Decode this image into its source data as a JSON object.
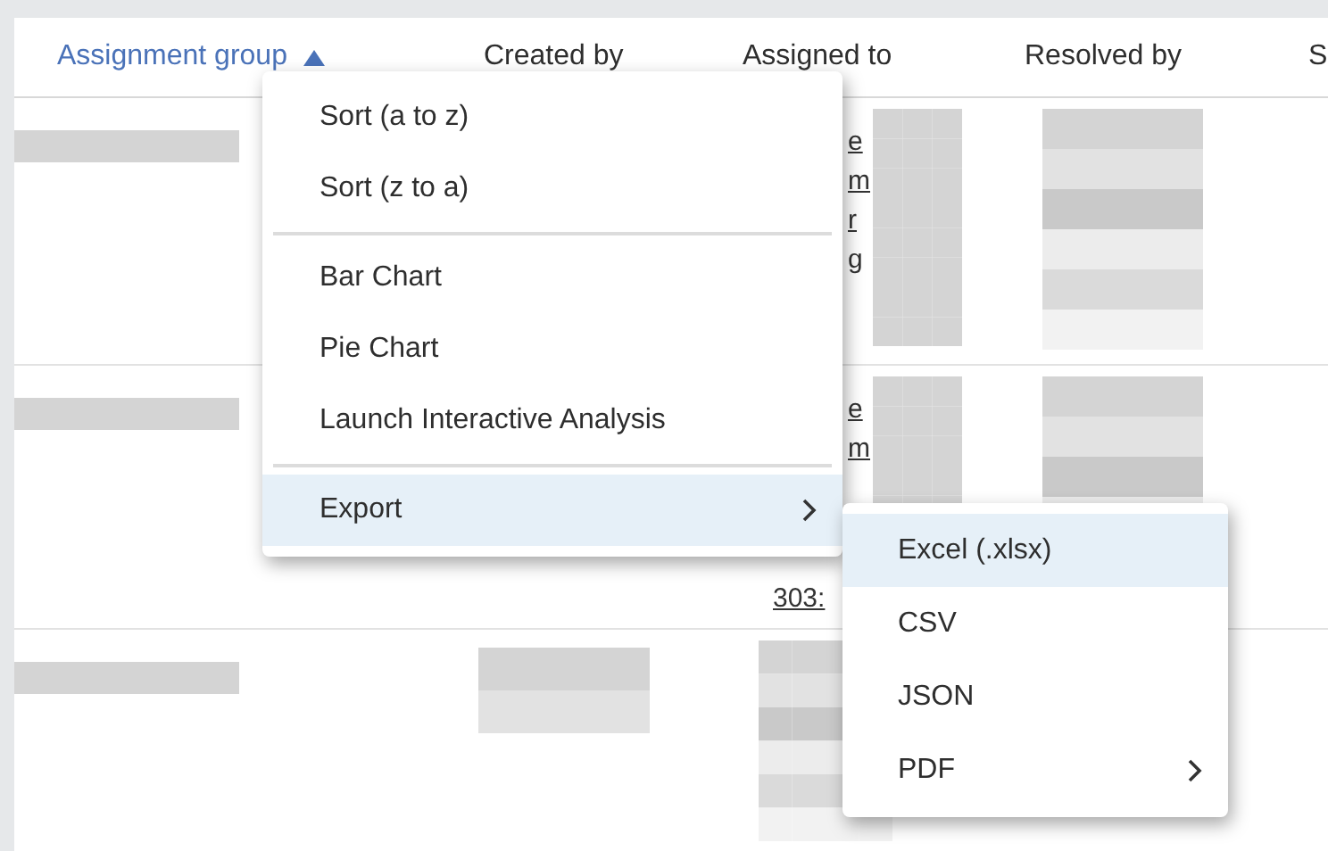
{
  "table": {
    "columns": [
      {
        "label": "Assignment group",
        "sorted": true
      },
      {
        "label": "Created by",
        "sorted": false
      },
      {
        "label": "Assigned to",
        "sorted": false
      },
      {
        "label": "Resolved by",
        "sorted": false
      },
      {
        "label": "S",
        "sorted": false
      }
    ],
    "rows": [
      {
        "assigned_to_fragments": [
          "e",
          "m",
          "r",
          "g"
        ]
      },
      {
        "assigned_to_fragments": [
          "e",
          "m"
        ],
        "assigned_to_link": "303:"
      },
      {}
    ]
  },
  "column_menu": {
    "items": [
      {
        "kind": "item",
        "label": "Sort (a to z)",
        "selected": false,
        "has_submenu": false
      },
      {
        "kind": "item",
        "label": "Sort (z to a)",
        "selected": false,
        "has_submenu": false
      },
      {
        "kind": "separator"
      },
      {
        "kind": "item",
        "label": "Bar Chart",
        "selected": false,
        "has_submenu": false
      },
      {
        "kind": "item",
        "label": "Pie Chart",
        "selected": false,
        "has_submenu": false
      },
      {
        "kind": "item",
        "label": "Launch Interactive Analysis",
        "selected": false,
        "has_submenu": false
      },
      {
        "kind": "separator"
      },
      {
        "kind": "item",
        "label": "Export",
        "selected": true,
        "has_submenu": true
      }
    ]
  },
  "export_submenu": {
    "items": [
      {
        "kind": "item",
        "label": "Excel (.xlsx)",
        "selected": true,
        "has_submenu": false
      },
      {
        "kind": "item",
        "label": "CSV",
        "selected": false,
        "has_submenu": false
      },
      {
        "kind": "item",
        "label": "JSON",
        "selected": false,
        "has_submenu": false
      },
      {
        "kind": "item",
        "label": "PDF",
        "selected": false,
        "has_submenu": true
      }
    ]
  }
}
